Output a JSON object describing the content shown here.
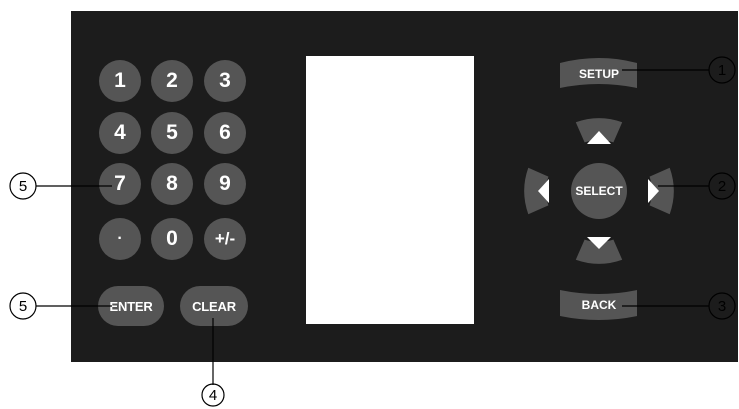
{
  "keypad": {
    "keys": [
      "1",
      "2",
      "3",
      "4",
      "5",
      "6",
      "7",
      "8",
      "9",
      "·",
      "0",
      "+/-"
    ],
    "enter": "ENTER",
    "clear": "CLEAR"
  },
  "nav": {
    "setup": "SETUP",
    "select": "SELECT",
    "back": "BACK"
  },
  "callouts": {
    "setup": "1",
    "nav_pad": "2",
    "back": "3",
    "clear": "4",
    "keypad": "5",
    "enter": "5"
  },
  "colors": {
    "panel": "#1c1c1c",
    "button": "#555555",
    "screen": "#ffffff",
    "label": "#ffffff"
  }
}
